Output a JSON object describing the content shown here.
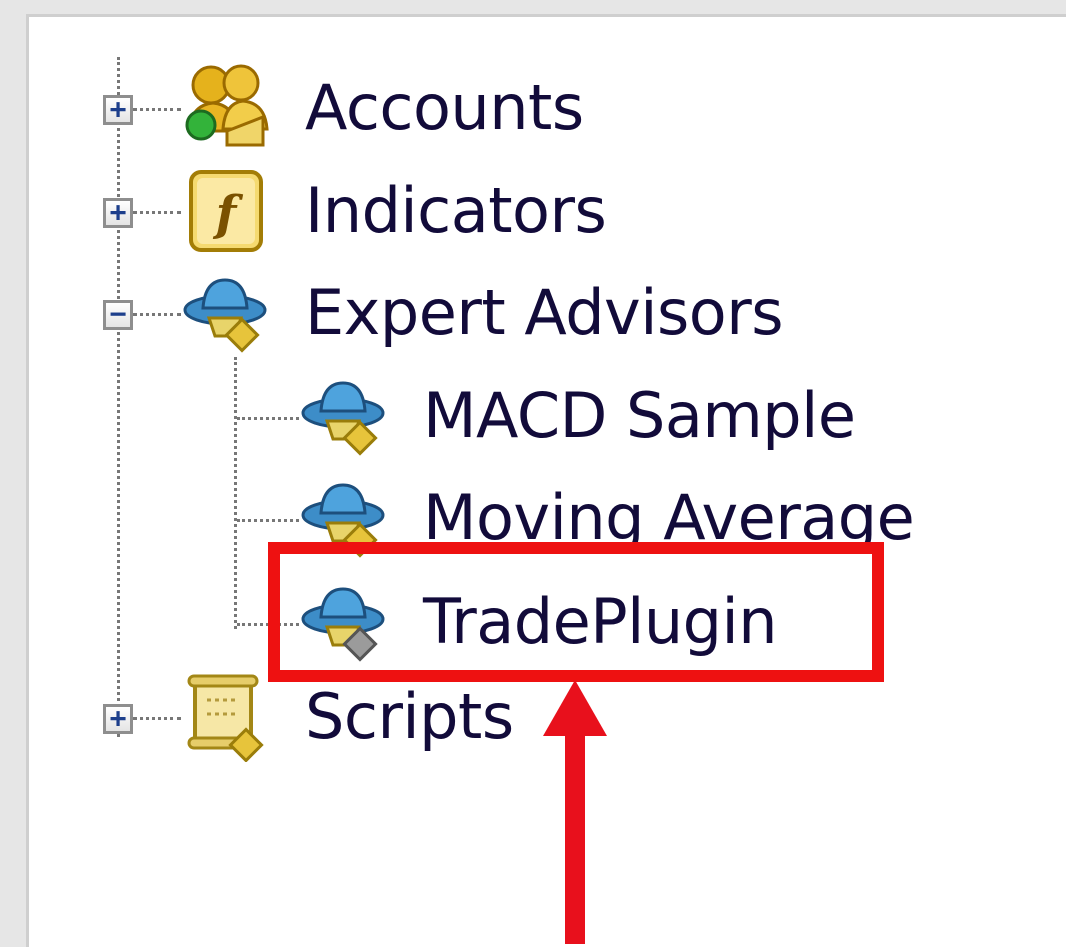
{
  "tree": {
    "items": [
      {
        "label": "Accounts",
        "icon": "accounts-icon",
        "toggle": "+"
      },
      {
        "label": "Indicators",
        "icon": "indicator-function-icon",
        "toggle": "+"
      },
      {
        "label": "Expert Advisors",
        "icon": "expert-advisor-hat-icon",
        "toggle": "−",
        "children": [
          {
            "label": "MACD Sample",
            "icon": "expert-advisor-hat-icon"
          },
          {
            "label": "Moving Average",
            "icon": "expert-advisor-hat-icon"
          },
          {
            "label": "TradePlugin",
            "icon": "expert-advisor-hat-icon"
          }
        ]
      },
      {
        "label": "Scripts",
        "icon": "script-scroll-icon",
        "toggle": "+"
      }
    ]
  },
  "annotation": {
    "highlight_color": "#ee1111",
    "arrow_color": "#e8101c"
  }
}
